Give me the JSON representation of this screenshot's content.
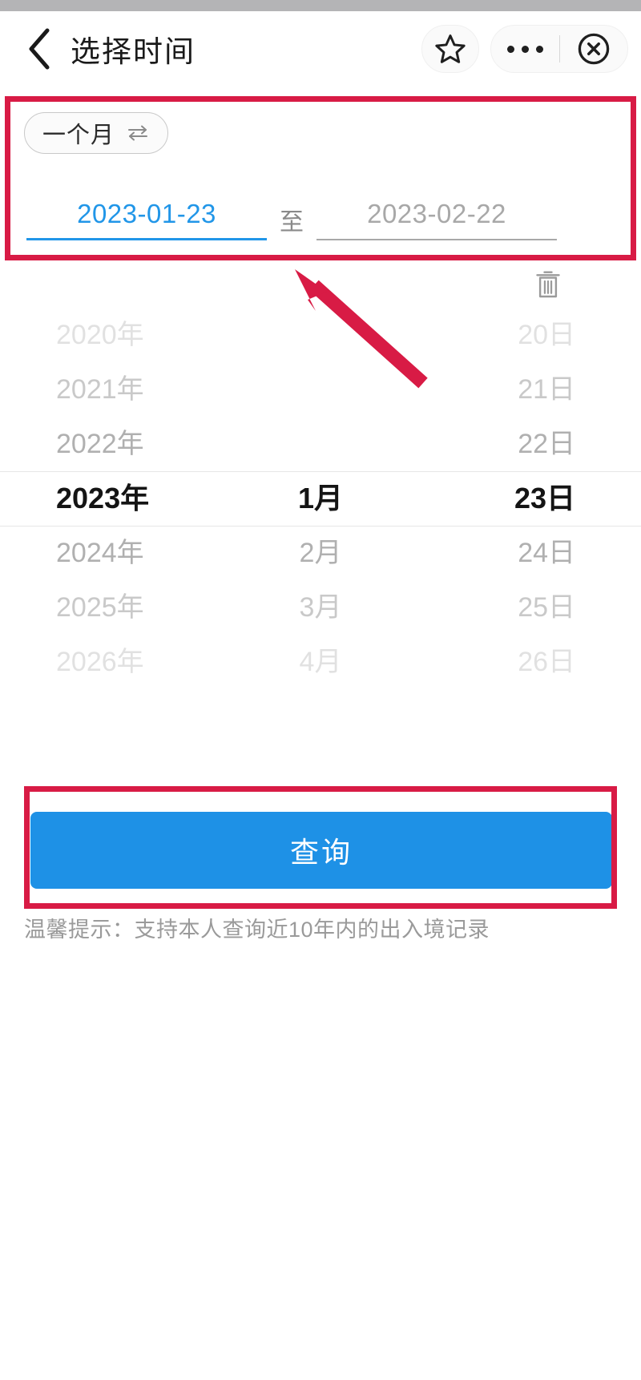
{
  "header": {
    "title": "选择时间",
    "back_icon": "chevron-left-icon",
    "favorite_icon": "star-icon",
    "more_icon": "ellipsis-icon",
    "close_icon": "circle-x-icon"
  },
  "range": {
    "quick_chip_label": "一个月",
    "quick_chip_icon": "swap-arrows-icon",
    "start_date": "2023-01-23",
    "separator": "至",
    "end_date": "2023-02-22",
    "active_field": "start_date",
    "delete_icon": "trash-icon",
    "accent_color": "#2196e8",
    "inactive_color": "#a8a8a8"
  },
  "picker": {
    "selected_year": "2023年",
    "selected_month": "1月",
    "selected_day": "23日",
    "years": [
      "2020年",
      "2021年",
      "2022年",
      "2023年",
      "2024年",
      "2025年",
      "2026年"
    ],
    "months": [
      "",
      "",
      "",
      "1月",
      "2月",
      "3月",
      "4月"
    ],
    "days": [
      "20日",
      "21日",
      "22日",
      "23日",
      "24日",
      "25日",
      "26日"
    ]
  },
  "actions": {
    "submit_label": "查询",
    "submit_color": "#1e91e6"
  },
  "hint": {
    "text": "温馨提示：支持本人查询近10年内的出入境记录"
  },
  "annotations": {
    "color": "#d81b45",
    "range_box": "highlight-date-range",
    "button_box": "highlight-query-button",
    "arrow": "arrow-pointing-to-date-range"
  }
}
